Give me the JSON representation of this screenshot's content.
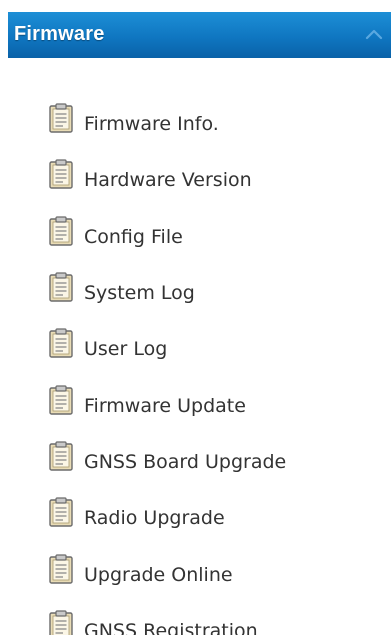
{
  "header": {
    "title": "Firmware",
    "collapse_icon": "chevron-up-icon"
  },
  "colors": {
    "header_bg": "#0f76c1",
    "header_text": "#ffffff",
    "item_text": "#333333",
    "icon_body": "#e9dcb6",
    "icon_outline": "#6b6b6b"
  },
  "menu": {
    "icon": "clipboard-icon",
    "items": [
      {
        "label": "Firmware Info."
      },
      {
        "label": "Hardware Version"
      },
      {
        "label": "Config File"
      },
      {
        "label": "System Log"
      },
      {
        "label": "User Log"
      },
      {
        "label": "Firmware Update"
      },
      {
        "label": "GNSS Board Upgrade"
      },
      {
        "label": "Radio Upgrade"
      },
      {
        "label": "Upgrade Online"
      },
      {
        "label": "GNSS Registration"
      }
    ]
  }
}
